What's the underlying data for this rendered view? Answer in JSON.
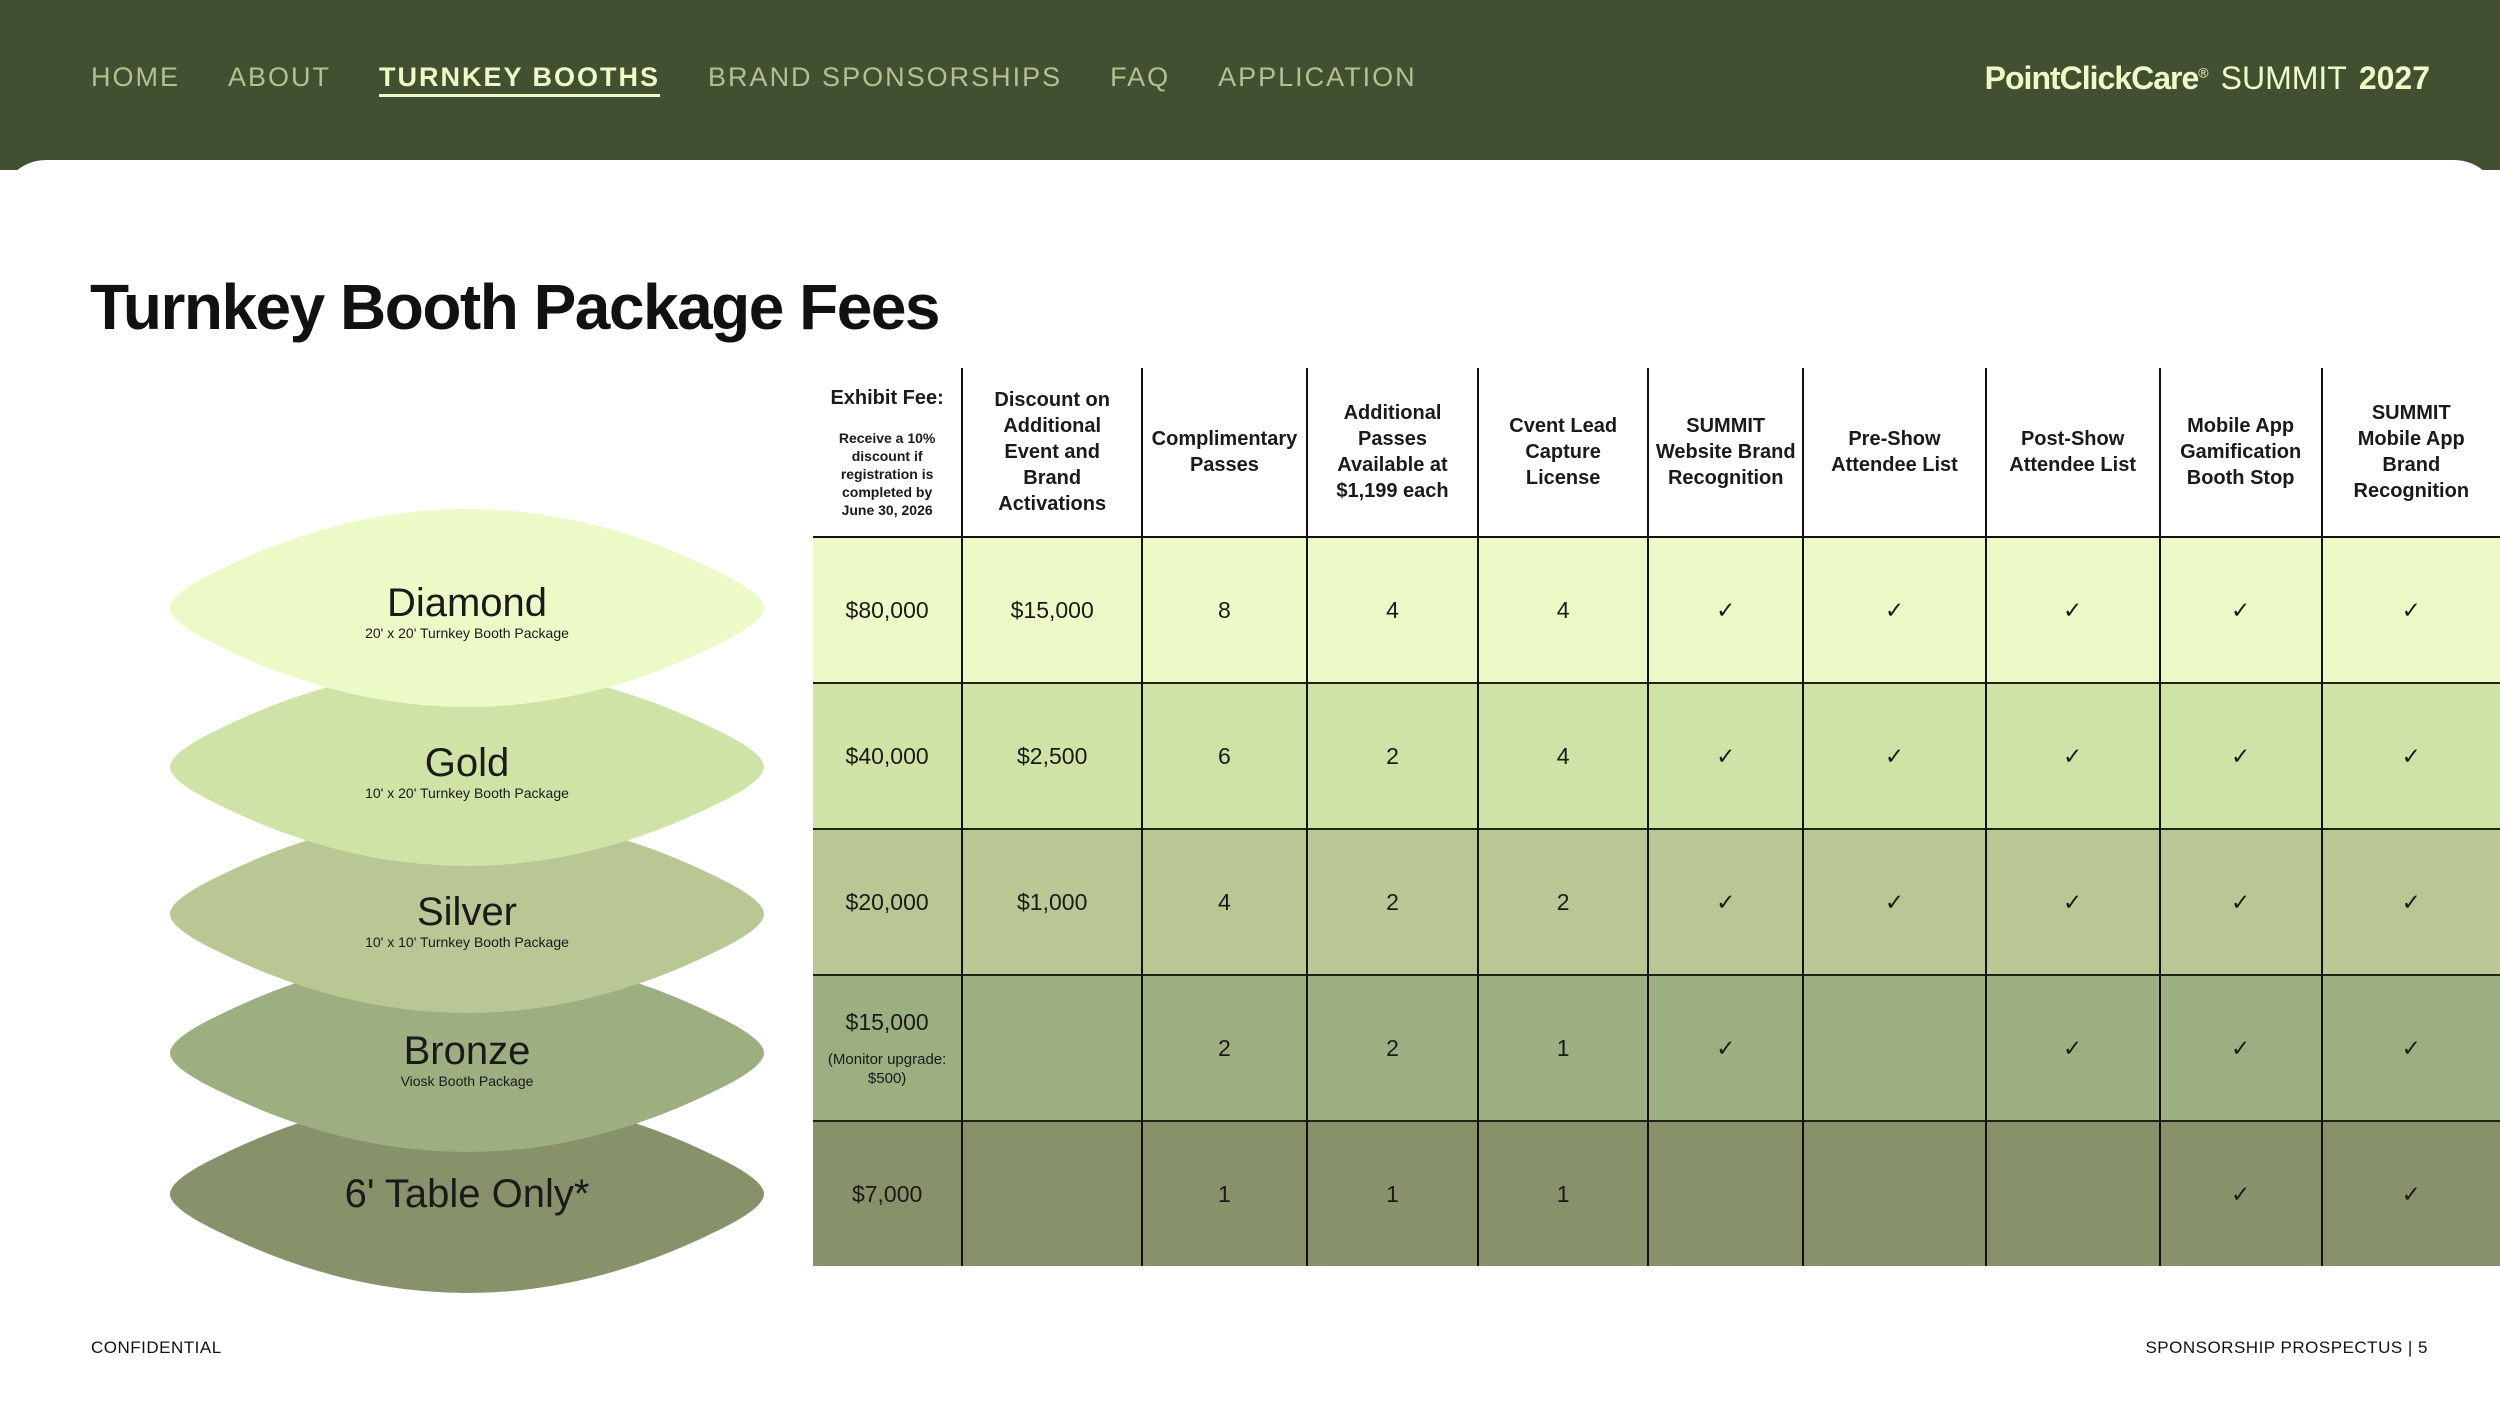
{
  "nav": {
    "items": [
      {
        "label": "HOME",
        "active": false
      },
      {
        "label": "ABOUT",
        "active": false
      },
      {
        "label": "TURNKEY BOOTHS",
        "active": true
      },
      {
        "label": "BRAND SPONSORSHIPS",
        "active": false
      },
      {
        "label": "FAQ",
        "active": false
      },
      {
        "label": "APPLICATION",
        "active": false
      }
    ]
  },
  "brand": {
    "company": "PointClickCare",
    "registered": "®",
    "event": "SUMMIT",
    "year": "2027"
  },
  "page_title": "Turnkey Booth Package Fees",
  "tiers": [
    {
      "name": "Diamond",
      "subtitle": "20' x 20' Turnkey Booth Package",
      "color": "#ebfac7"
    },
    {
      "name": "Gold",
      "subtitle": "10' x 20' Turnkey Booth Package",
      "color": "#d0e3a6"
    },
    {
      "name": "Silver",
      "subtitle": "10' x 10' Turnkey Booth Package",
      "color": "#b8c794"
    },
    {
      "name": "Bronze",
      "subtitle": "Viosk Booth Package",
      "color": "#9dae80"
    },
    {
      "name": "6' Table Only*",
      "subtitle": "",
      "color": "#87926a"
    }
  ],
  "table": {
    "headers": [
      {
        "label": "Exhibit Fee:",
        "note": "Receive a 10% discount if registration is completed by June 30, 2026"
      },
      {
        "label": "Discount on Additional Event and Brand Activations",
        "note": ""
      },
      {
        "label": "Complimentary Passes",
        "note": ""
      },
      {
        "label": "Additional Passes Available at $1,199 each",
        "note": ""
      },
      {
        "label": "Cvent Lead Capture License",
        "note": ""
      },
      {
        "label": "SUMMIT Website Brand Recognition",
        "note": ""
      },
      {
        "label": "Pre-Show Attendee List",
        "note": ""
      },
      {
        "label": "Post-Show Attendee List",
        "note": ""
      },
      {
        "label": "Mobile App Gamification Booth Stop",
        "note": ""
      },
      {
        "label": "SUMMIT Mobile App Brand Recognition",
        "note": ""
      }
    ],
    "rows": [
      [
        "$80,000",
        "$15,000",
        "8",
        "4",
        "4",
        "✓",
        "✓",
        "✓",
        "✓",
        "✓"
      ],
      [
        "$40,000",
        "$2,500",
        "6",
        "2",
        "4",
        "✓",
        "✓",
        "✓",
        "✓",
        "✓"
      ],
      [
        "$20,000",
        "$1,000",
        "4",
        "2",
        "2",
        "✓",
        "✓",
        "✓",
        "✓",
        "✓"
      ],
      [
        "$15,000",
        "",
        "2",
        "2",
        "1",
        "✓",
        "",
        "✓",
        "✓",
        "✓"
      ],
      [
        "$7,000",
        "",
        "1",
        "1",
        "1",
        "",
        "",
        "",
        "✓",
        "✓"
      ]
    ],
    "row_notes": [
      "",
      "",
      "",
      "(Monitor upgrade: $500)",
      ""
    ]
  },
  "footer": {
    "left": "CONFIDENTIAL",
    "right": "SPONSORSHIP PROSPECTUS | 5"
  },
  "colors": {
    "header_bg": "#425031",
    "nav_text": "#b4c092",
    "nav_active": "#eefbc6"
  }
}
